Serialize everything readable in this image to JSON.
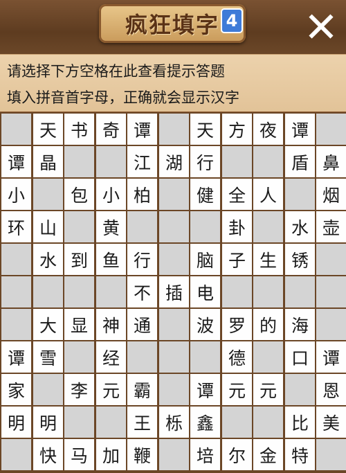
{
  "header": {
    "title": "疯狂填字",
    "level_badge": "4",
    "close_label": "✕"
  },
  "hint": {
    "line1": "请选择下方空格在此查看提示答题",
    "line2": "填入拼音首字母，正确就会显示汉字"
  },
  "grid": {
    "rows": [
      [
        "",
        "天",
        "书",
        "奇",
        "谭",
        "",
        "天",
        "方",
        "夜",
        "谭",
        ""
      ],
      [
        "谭",
        "晶",
        "",
        "",
        "江",
        "湖",
        "行",
        "",
        "",
        "盾",
        "鼻"
      ],
      [
        "小",
        "",
        "包",
        "小",
        "柏",
        "",
        "健",
        "全",
        "人",
        "",
        "烟"
      ],
      [
        "环",
        "山",
        "",
        "黄",
        "",
        "",
        "",
        "卦",
        "",
        "水",
        "壶"
      ],
      [
        "",
        "水",
        "到",
        "鱼",
        "行",
        "",
        "脑",
        "子",
        "生",
        "锈",
        ""
      ],
      [
        "",
        "",
        "",
        "",
        "不",
        "插",
        "电",
        "",
        "",
        "",
        ""
      ],
      [
        "",
        "大",
        "显",
        "神",
        "通",
        "",
        "波",
        "罗",
        "的",
        "海",
        ""
      ],
      [
        "谭",
        "雪",
        "",
        "经",
        "",
        "",
        "",
        "德",
        "",
        "口",
        "谭"
      ],
      [
        "家",
        "",
        "李",
        "元",
        "霸",
        "",
        "谭",
        "元",
        "元",
        "",
        "恩"
      ],
      [
        "明",
        "明",
        "",
        "",
        "王",
        "栎",
        "鑫",
        "",
        "",
        "比",
        "美"
      ],
      [
        "",
        "快",
        "马",
        "加",
        "鞭",
        "",
        "培",
        "尔",
        "金",
        "特",
        ""
      ]
    ]
  }
}
